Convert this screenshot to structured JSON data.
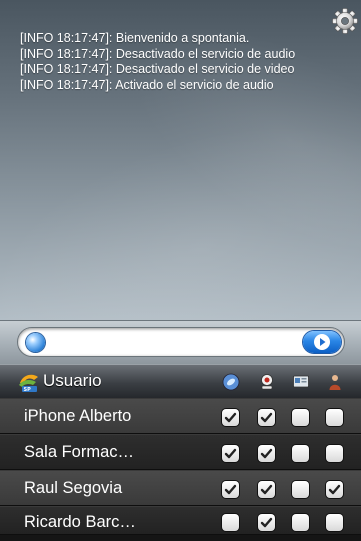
{
  "log": {
    "lines": [
      "[INFO 18:17:47]: Bienvenido a spontania.",
      "[INFO 18:17:47]: Desactivado el servicio de audio",
      "[INFO 18:17:47]: Desactivado el servicio de video",
      "[INFO 18:17:47]: Activado el servicio de audio"
    ]
  },
  "search": {
    "value": "",
    "placeholder": ""
  },
  "users_header": {
    "title": "Usuario",
    "columns": [
      "chat-icon",
      "webcam-icon",
      "presentation-icon",
      "person-icon"
    ]
  },
  "users": [
    {
      "name": "iPhone Alberto",
      "checks": [
        true,
        true,
        false,
        false
      ]
    },
    {
      "name": "Sala Formac…",
      "checks": [
        true,
        true,
        false,
        false
      ]
    },
    {
      "name": "Raul Segovia",
      "checks": [
        true,
        true,
        false,
        true
      ]
    },
    {
      "name": "Ricardo Barc…",
      "checks": [
        false,
        true,
        false,
        false
      ]
    }
  ],
  "colors": {
    "accent_blue": "#2a86e6",
    "row_text": "#ffffff"
  }
}
